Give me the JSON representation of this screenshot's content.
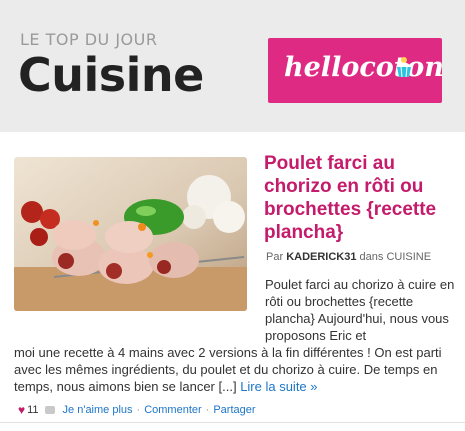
{
  "header": {
    "kicker": "LE TOP DU JOUR",
    "title": "Cuisine",
    "logo_text": "hellocoton"
  },
  "article": {
    "title": "Poulet farci au chorizo en rôti ou brochettes {recette plancha}",
    "byline_prefix": "Par",
    "author": "KADERICK31",
    "byline_middle": "dans",
    "category": "CUISINE",
    "excerpt_part1": "Poulet farci au chorizo à cuire en rôti ou brochettes {recette plancha} Aujourd'hui, nous vous proposons Eric et",
    "excerpt_part2": "moi une recette à 4 mains avec 2 versions à la fin différentes ! On est parti avec les mêmes ingrédients, du poulet et du chorizo à cuire. De temps en temps, nous aimons bien se lancer [...]",
    "read_more": "Lire la suite »"
  },
  "footer": {
    "likes": "11",
    "dislike": "Je n'aime plus",
    "comment": "Commenter",
    "share": "Partager",
    "sep": "·"
  },
  "colors": {
    "brand_pink": "#df2a83",
    "title_pink": "#c41b6b",
    "link_blue": "#1d76c8"
  }
}
